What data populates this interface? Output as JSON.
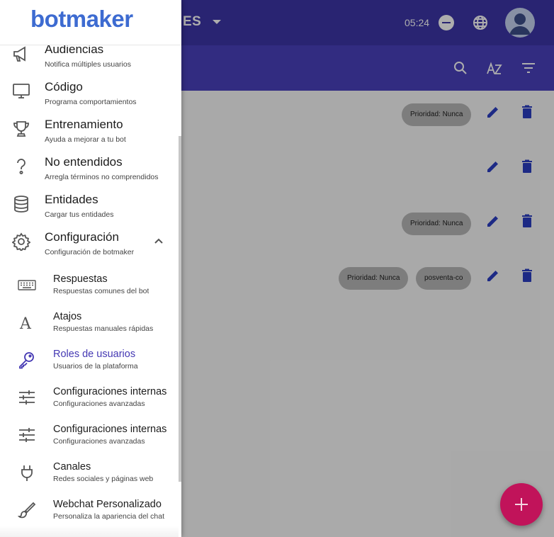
{
  "topbar": {
    "language": "ES",
    "time": "05:24"
  },
  "list": {
    "rows": [
      {
        "chips": [
          "Prioridad: Nunca"
        ]
      },
      {
        "chips": []
      },
      {
        "chips": [
          "Prioridad: Nunca"
        ]
      },
      {
        "chips": [
          "Prioridad: Nunca",
          "posventa-co"
        ]
      }
    ]
  },
  "drawer": {
    "logo": "botmaker",
    "items": [
      {
        "title": "Audiencias",
        "subtitle": "Notifica múltiples usuarios",
        "icon": "megaphone-icon"
      },
      {
        "title": "Código",
        "subtitle": "Programa comportamientos",
        "icon": "monitor-icon"
      },
      {
        "title": "Entrenamiento",
        "subtitle": "Ayuda a mejorar a tu bot",
        "icon": "trophy-icon"
      },
      {
        "title": "No entendidos",
        "subtitle": "Arregla términos no comprendidos",
        "icon": "question-icon"
      },
      {
        "title": "Entidades",
        "subtitle": "Cargar tus entidades",
        "icon": "database-icon"
      },
      {
        "title": "Configuración",
        "subtitle": "Configuración de botmaker",
        "icon": "gear-icon"
      }
    ],
    "subitems": [
      {
        "title": "Respuestas",
        "subtitle": "Respuestas comunes del bot",
        "icon": "keyboard-icon"
      },
      {
        "title": "Atajos",
        "subtitle": "Respuestas manuales rápidas",
        "icon": "font-icon"
      },
      {
        "title": "Roles de usuarios",
        "subtitle": "Usuarios de la plataforma",
        "icon": "key-icon"
      },
      {
        "title": "Configuraciones internas",
        "subtitle": "Configuraciones avanzadas",
        "icon": "sliders-icon"
      },
      {
        "title": "Configuraciones internas",
        "subtitle": "Configuraciones avanzadas",
        "icon": "sliders-icon"
      },
      {
        "title": "Canales",
        "subtitle": "Redes sociales y páginas web",
        "icon": "plug-icon"
      },
      {
        "title": "Webchat Personalizado",
        "subtitle": "Personaliza la apariencia del chat",
        "icon": "brush-icon"
      }
    ]
  },
  "colors": {
    "primary": "#3d35a8",
    "accent": "#c1135a",
    "active": "#4438b3",
    "action_icon": "#2b3fc4"
  }
}
